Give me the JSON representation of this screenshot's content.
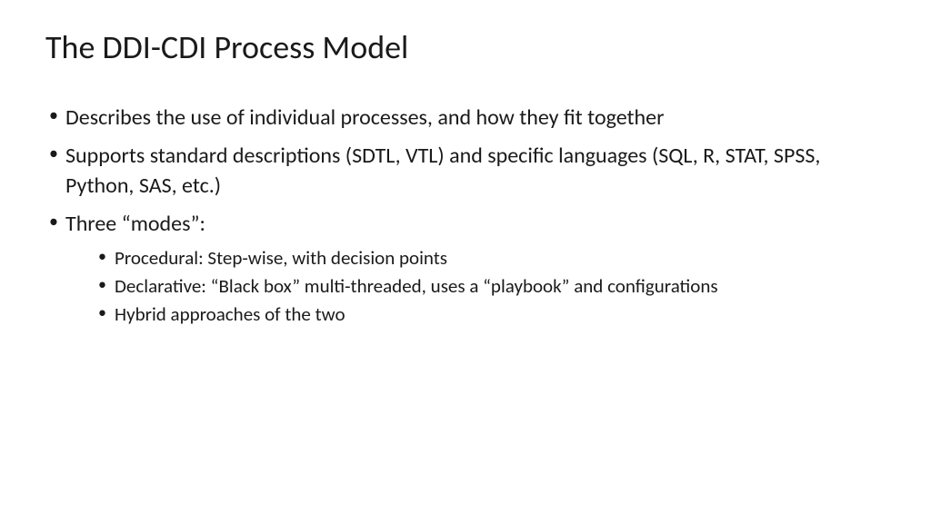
{
  "title": "The DDI-CDI Process Model",
  "bullets": [
    "Describes the use of individual processes, and how they fit together",
    "Supports standard descriptions (SDTL, VTL) and specific languages (SQL, R, STAT, SPSS, Python, SAS, etc.)",
    "Three “modes”:"
  ],
  "sub_bullets": [
    "Procedural: Step-wise, with decision points",
    "Declarative: “Black box” multi-threaded, uses a “playbook” and configurations",
    "Hybrid approaches of the two"
  ]
}
